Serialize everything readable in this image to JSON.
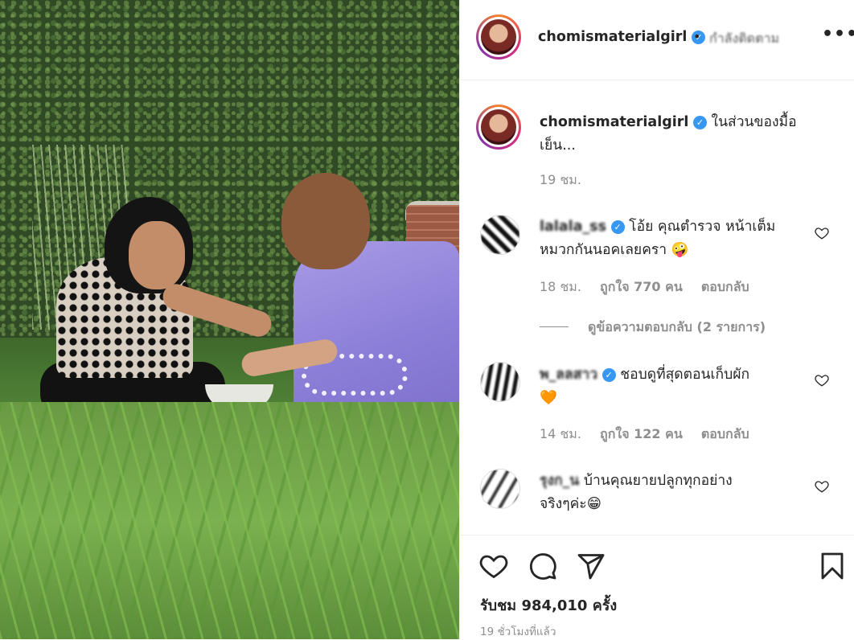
{
  "post": {
    "username": "chomismaterialgirl",
    "follow_text": "กำลังติดตาม",
    "more_label": "•••",
    "caption": "ในส่วนของมื้อ",
    "caption_cont": "เย็น...",
    "caption_time": "19 ชม."
  },
  "comments": [
    {
      "username": "lalala_ss",
      "text_line1": "โอ้ย คุณตำรวจ หน้าเต็ม",
      "text_line2": "หมวกกันนอคเลยครา 🤪",
      "time": "18 ชม.",
      "likes": "ถูกใจ 770 คน",
      "reply": "ตอบกลับ",
      "view_replies": "ดูข้อความตอบกลับ (2 รายการ)"
    },
    {
      "username": "พ_ลลสาว",
      "text_line1": "ชอบดูที่สุดตอนเก็บผัก",
      "text_line2": "🧡",
      "time": "14 ชม.",
      "likes": "ถูกใจ 122 คน",
      "reply": "ตอบกลับ"
    },
    {
      "username": "รุงก_น",
      "text_line1": "บ้านคุณยายปลูกทุกอย่าง",
      "text_line2": "จริงๆค่ะ😁"
    }
  ],
  "footer": {
    "views": "รับชม 984,010 ครั้ง",
    "time_ago": "19 ชั่วโมงที่แล้ว"
  },
  "icons": {
    "like": "heart-icon",
    "comment": "comment-bubble-icon",
    "share": "paper-plane-icon",
    "save": "bookmark-icon",
    "verified": "verified-badge-icon"
  },
  "colors": {
    "verified": "#3897f0",
    "meta_text": "#8e8e8e",
    "text": "#262626",
    "avatar_ring_start": "#f58529",
    "avatar_ring_mid": "#dd2a7b"
  }
}
